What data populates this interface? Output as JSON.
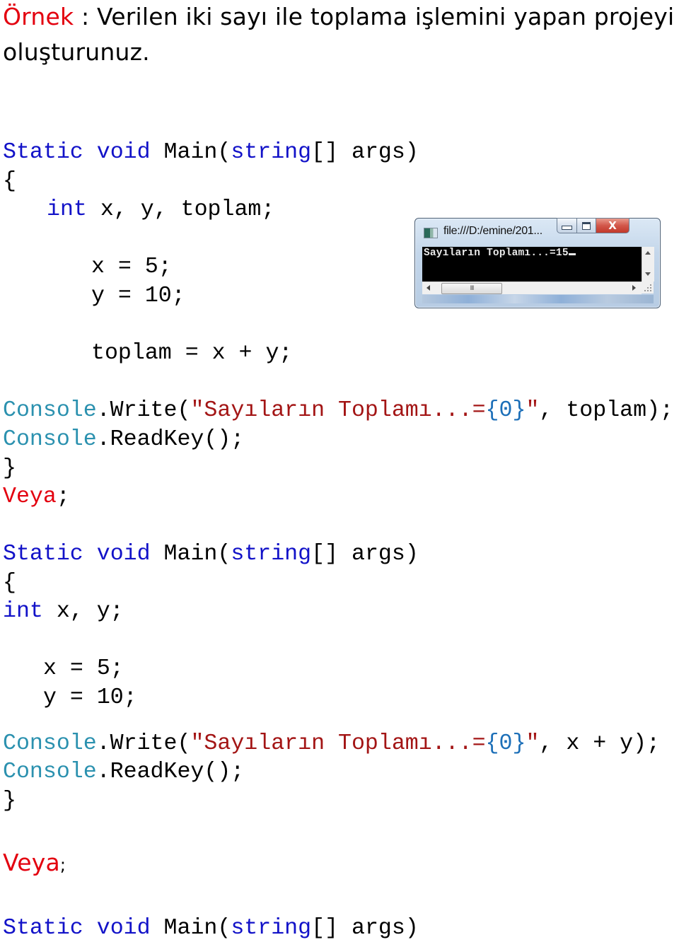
{
  "heading": {
    "label": "Örnek",
    "separator": " : ",
    "line1_rest": "Verilen iki sayı ile toplama işlemini yapan projeyi",
    "line2": "oluşturunuz."
  },
  "colors": {
    "accent_red": "#e3000f",
    "keyword": "#1212c8",
    "type": "#2b91af",
    "string": "#a31515",
    "placeholder": "#1c6fb8"
  },
  "example1": {
    "sig": {
      "kw1": "Static",
      "kw2": "void",
      "name": "Main(",
      "type": "string",
      "rest": "[] args)"
    },
    "open_brace": "{",
    "decl": {
      "kw": "int",
      "rest": " x, y, toplam;"
    },
    "assign_x": "x = 5;",
    "assign_y": "y = 10;",
    "sum": "toplam = x + y;",
    "write": {
      "type": "Console",
      "method": ".Write(",
      "str1": "\"Sayıların Toplamı...=",
      "ph": "{0}",
      "str2": "\"",
      "rest": ", toplam);"
    },
    "readkey": {
      "type": "Console",
      "rest": ".ReadKey();"
    },
    "close_brace": "}"
  },
  "veya1": {
    "word": "Veya",
    "punct": ";"
  },
  "example2": {
    "sig": {
      "kw1": "Static",
      "kw2": "void",
      "name": "Main(",
      "type": "string",
      "rest": "[] args)"
    },
    "open_brace": "{",
    "decl": {
      "kw": "int",
      "rest": " x, y;"
    },
    "assign_x": "x = 5;",
    "assign_y": "y = 10;",
    "write": {
      "type": "Console",
      "method": ".Write(",
      "str1": "\"Sayıların Toplamı...=",
      "ph": "{0}",
      "str2": "\"",
      "rest": ", x + y);"
    },
    "readkey": {
      "type": "Console",
      "rest": ".ReadKey();"
    },
    "close_brace": "}"
  },
  "veya2": {
    "word": "Veya",
    "punct": ";"
  },
  "example3": {
    "sig": {
      "kw1": "Static",
      "kw2": "void",
      "name": "Main(",
      "type": "string",
      "rest": "[] args)"
    }
  },
  "console_window": {
    "title": "file:///D:/emine/201...",
    "icons": {
      "app": "console-app-icon",
      "minimize": "minimize-icon",
      "maximize": "maximize-icon",
      "close": "close-icon"
    },
    "close_glyph": "X",
    "output": "Sayıların Toplamı...=15",
    "scroll_thumb_glyph": "III"
  }
}
